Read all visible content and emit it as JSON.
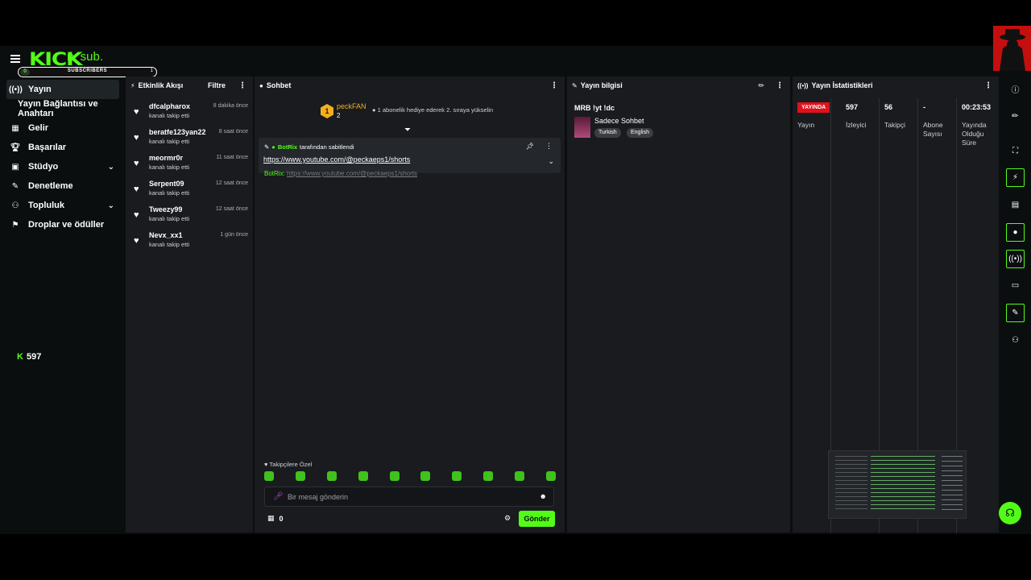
{
  "header": {
    "logo": "KICK",
    "overlay_text": "rx sub.",
    "sub_goal": {
      "current": "0",
      "label": "SUBSCRIBERS",
      "target": "1"
    }
  },
  "sidebar": {
    "items": [
      {
        "icon": "broadcast-icon",
        "label": "Yayın",
        "active": true
      },
      {
        "icon": "",
        "label": "Yayın Bağlantısı ve Anahtarı"
      },
      {
        "icon": "money-icon",
        "label": "Gelir"
      },
      {
        "icon": "trophy-icon",
        "label": "Başarılar"
      },
      {
        "icon": "studio-icon",
        "label": "Stüdyo",
        "expandable": true
      },
      {
        "icon": "wrench-icon",
        "label": "Denetleme"
      },
      {
        "icon": "community-icon",
        "label": "Topluluk",
        "expandable": true
      },
      {
        "icon": "gift-icon",
        "label": "Droplar ve ödüller"
      }
    ],
    "viewer_count": "597"
  },
  "activity": {
    "title": "Etkinlik Akışı",
    "filter_label": "Filtre",
    "events": [
      {
        "user": "dfcalpharox",
        "action": "kanalı takip etti",
        "time": "8 dakika önce"
      },
      {
        "user": "beratfe123yan22",
        "action": "kanalı takip etti",
        "time": "8 saat önce"
      },
      {
        "user": "meormr0r",
        "action": "kanalı takip etti",
        "time": "11 saat önce"
      },
      {
        "user": "Serpent09",
        "action": "kanalı takip etti",
        "time": "12 saat önce"
      },
      {
        "user": "Tweezy99",
        "action": "kanalı takip etti",
        "time": "12 saat önce"
      },
      {
        "user": "Nevx_xx1",
        "action": "kanalı takip etti",
        "time": "1 gün önce"
      }
    ]
  },
  "chat": {
    "title": "Sohbet",
    "top_gifter": {
      "rank": "1",
      "name": "peckFAN",
      "count": "2"
    },
    "gift_message": "1 abonelik hediye ederek 2. sıraya yükselin",
    "pinned": {
      "bot_name": "BotRix",
      "pinned_by_suffix": "tarafından sabitlendi",
      "link": "https://www.youtube.com/@peckaeps1/shorts"
    },
    "ghost_message": {
      "user": "BotRix:",
      "text": "https://www.youtube.com/@peckaeps1/shorts"
    },
    "followers_only": "Takipçilere Özel",
    "input_placeholder": "Bir mesaj gönderin",
    "gift_count": "0",
    "send_label": "Gönder"
  },
  "stream_info": {
    "title": "Yayın bilgisi",
    "stream_title": "MRB !yt !dc",
    "category": "Sadece Sohbet",
    "tags": [
      "Turkish",
      "English"
    ]
  },
  "stats": {
    "title": "Yayın İstatistikleri",
    "live_badge": "YAYINDA",
    "columns": [
      {
        "value": "",
        "label": "Yayın"
      },
      {
        "value": "597",
        "label": "İzleyici"
      },
      {
        "value": "56",
        "label": "Takipçi"
      },
      {
        "value": "-",
        "label": "Abone Sayısı"
      },
      {
        "value": "00:23:53",
        "label": "Yayında Olduğu Süre"
      }
    ]
  }
}
